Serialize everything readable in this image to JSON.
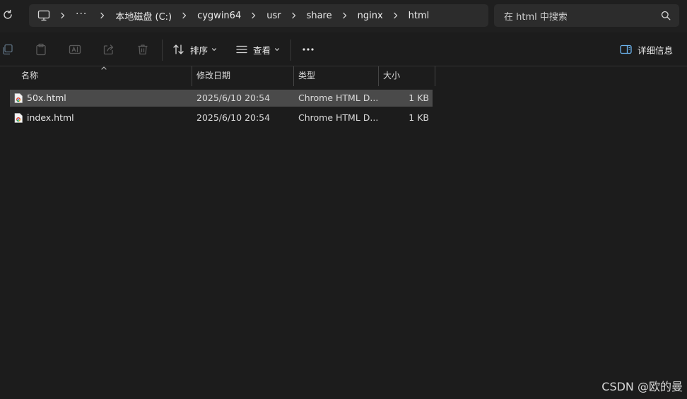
{
  "address": {
    "segments": [
      "本地磁盘 (C:)",
      "cygwin64",
      "usr",
      "share",
      "nginx",
      "html"
    ],
    "overflow": "···"
  },
  "search": {
    "placeholder": "在 html 中搜索"
  },
  "toolbar": {
    "sort_label": "排序",
    "view_label": "查看",
    "details_label": "详细信息"
  },
  "columns": {
    "name": "名称",
    "modified": "修改日期",
    "type": "类型",
    "size": "大小"
  },
  "files": [
    {
      "name": "50x.html",
      "modified": "2025/6/10 20:54",
      "type": "Chrome HTML D...",
      "size": "1 KB",
      "selected": true
    },
    {
      "name": "index.html",
      "modified": "2025/6/10 20:54",
      "type": "Chrome HTML D...",
      "size": "1 KB",
      "selected": false
    }
  ],
  "watermark": "CSDN @欧的曼",
  "colors": {
    "background": "#1c1c1c",
    "selection": "#4a4a4a",
    "field": "#2c2c2c"
  }
}
